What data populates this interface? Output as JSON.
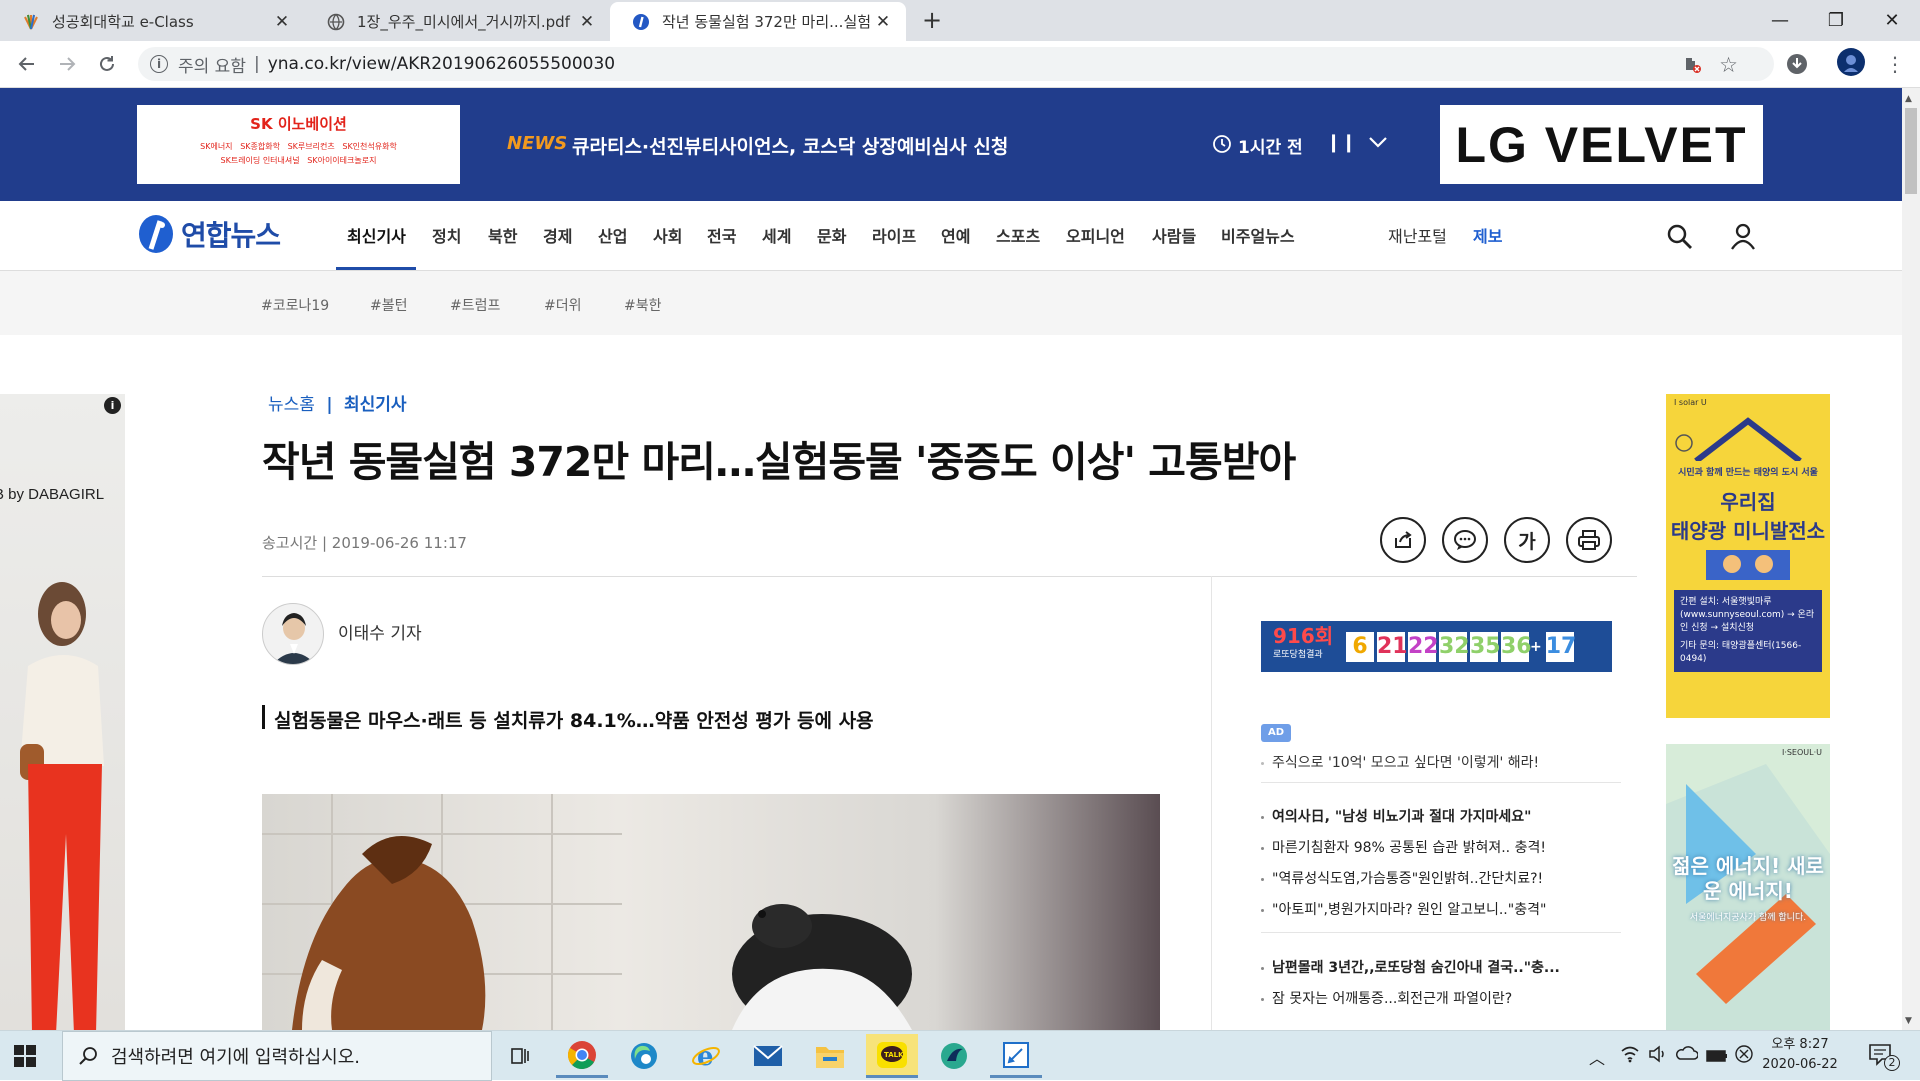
{
  "browser": {
    "tabs": [
      {
        "title": "성공회대학교 e-Class"
      },
      {
        "title": "1장_우주_미시에서_거시까지.pdf"
      },
      {
        "title": "작년 동물실험 372만 마리...실험"
      }
    ],
    "security_label": "주의 요함",
    "url": "yna.co.kr/view/AKR20190626055500030"
  },
  "top_banner": {
    "news_tag": "NEWS",
    "headline": "큐라티스·선진뷰티사이언스, 코스닥 상장예비심사 신청",
    "time": "1시간 전",
    "ad_left_brand": "SK 이노베이션",
    "ad_left_items": [
      "SK에너지",
      "SK종합화학",
      "SK루브리컨츠",
      "SK인천석유화학",
      "SK트레이딩 인터내셔널",
      "SK아이이테크놀로지"
    ],
    "ad_right": "LG VELVET"
  },
  "site": {
    "logo": "연합뉴스",
    "nav": [
      "최신기사",
      "정치",
      "북한",
      "경제",
      "산업",
      "사회",
      "전국",
      "세계",
      "문화",
      "라이프",
      "연예",
      "스포츠",
      "오피니언",
      "사람들",
      "비주얼뉴스"
    ],
    "nav_right": [
      "재난포털",
      "제보"
    ],
    "tags": [
      "#코로나19",
      "#볼턴",
      "#트럼프",
      "#더위",
      "#북한"
    ]
  },
  "article": {
    "breadcrumb_home": "뉴스홈",
    "breadcrumb_sep": "|",
    "breadcrumb_current": "최신기사",
    "title": "작년 동물실험 372만 마리…실험동물 '중증도 이상' 고통받아",
    "time_label": "송고시간 | 2019-06-26 11:17",
    "reporter": "이태수 기자",
    "subhead": "실험동물은 마우스·래트 등 설치류가 84.1%…약품 안전성 평가 등에 사용",
    "font_button": "가"
  },
  "sidebar": {
    "lotto_round": "916회",
    "lotto_caption": "로또당첨결과",
    "lotto_numbers": [
      "6",
      "21",
      "22",
      "32",
      "35",
      "36"
    ],
    "lotto_bonus": "17",
    "lotto_plus": "+",
    "ad_badge": "AD",
    "ad_links_1": [
      "주식으로 '10억' 모으고 싶다면 '이렇게' 해라!"
    ],
    "ad_links_2": [
      "여의사日, \"남성 비뇨기과 절대 가지마세요\"",
      "마른기침환자 98% 공통된 습관 밝혀져.. 충격!",
      "\"역류성식도염,가슴통증\"원인밝혀..간단치료?!",
      "\"아토피\",병원가지마라? 원인 알고보니..\"충격\""
    ],
    "ad_links_3": [
      "남편몰래 3년간,,로또당첨 숨긴아내 결국..\"충...",
      "잠 못자는 어깨통증...회전근개 파열이란?"
    ]
  },
  "left_ad": {
    "text": "B by DABAGIRL"
  },
  "right_ads": {
    "ad1_top": "I solar U",
    "ad1_caption": "시민과 함께 만드는 태양의 도시 서울",
    "ad1_title1": "우리집",
    "ad1_title2": "태양광 미니발전소",
    "ad1_info1": "간편 설치: 서울햇빛마루 (www.sunnyseoul.com) → 온라인 신청 → 설치신청",
    "ad1_info2": "기타 문의: 태양광플센터(1566-0494)",
    "ad2_top": "I·SEOUL·U",
    "ad2_title": "젊은 에너지! 새로운 에너지!",
    "ad2_caption": "서울에너지공사가 함께 합니다."
  },
  "taskbar": {
    "search_placeholder": "검색하려면 여기에 입력하십시오.",
    "time": "오후 8:27",
    "date": "2020-06-22",
    "notification_count": "2"
  },
  "colors": {
    "brand_blue": "#213d8c",
    "link_blue": "#1a5fbf"
  }
}
